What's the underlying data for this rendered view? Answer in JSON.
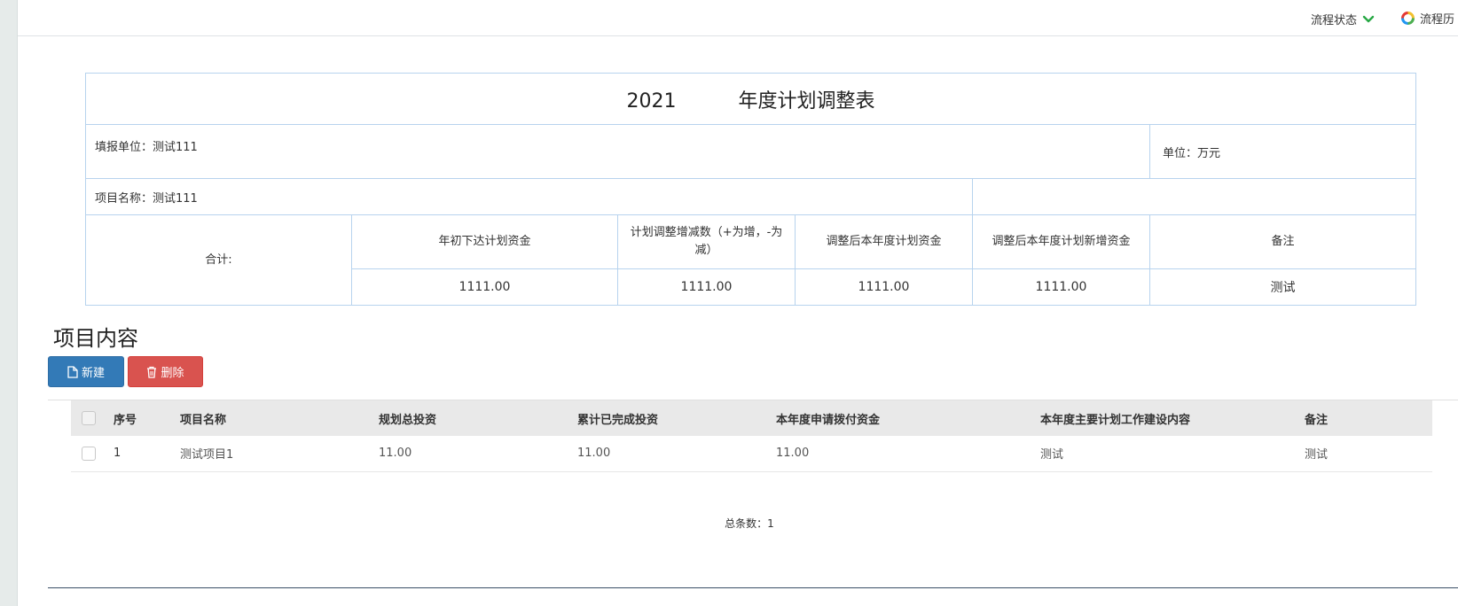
{
  "topbar": {
    "status_label": "流程状态",
    "history_label": "流程历"
  },
  "plan": {
    "year": "2021",
    "title": "年度计划调整表",
    "report_unit_label": "填报单位：",
    "report_unit_value": "测试111",
    "unit_label": "单位：",
    "unit_value": "万元",
    "project_name_label": "项目名称：",
    "project_name_value": "测试111",
    "total_label": "合计:",
    "headers": [
      "年初下达计划资金",
      "计划调整增减数（+为增，-为减）",
      "调整后本年度计划资金",
      "调整后本年度计划新增资金",
      "备注"
    ],
    "values": [
      "1111.00",
      "1111.00",
      "1111.00",
      "1111.00",
      "测试"
    ]
  },
  "section": {
    "title": "项目内容"
  },
  "toolbar": {
    "new_label": "新建",
    "delete_label": "删除"
  },
  "list": {
    "columns": [
      "序号",
      "项目名称",
      "规划总投资",
      "累计已完成投资",
      "本年度申请拨付资金",
      "本年度主要计划工作建设内容",
      "备注"
    ],
    "rows": [
      [
        "1",
        "测试项目1",
        "11.00",
        "11.00",
        "11.00",
        "测试",
        "测试"
      ]
    ]
  },
  "footer": {
    "total_count": "总条数：1"
  },
  "colors": {
    "primary": "#337ab7",
    "danger": "#d9534f",
    "table_border": "#b7d3ee",
    "status_chevron": "#27a844"
  },
  "icons": {
    "status_toggle": "chevron-down-icon",
    "history": "ring-icon",
    "new": "file-icon",
    "delete": "trash-icon"
  }
}
